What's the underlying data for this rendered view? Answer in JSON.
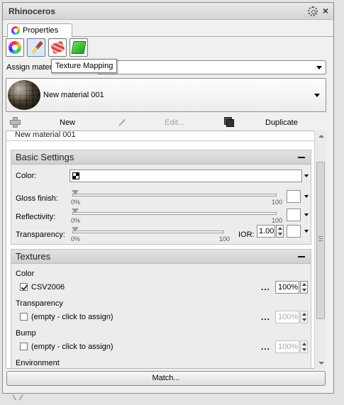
{
  "window": {
    "title": "Rhinoceros"
  },
  "tabs": [
    {
      "label": "Properties"
    }
  ],
  "icon_buttons": [
    {
      "icon": "material-icon"
    },
    {
      "icon": "paintbrush-icon"
    },
    {
      "icon": "texture-mapping-icon"
    },
    {
      "icon": "decal-icon"
    }
  ],
  "tooltip": {
    "text": "Texture Mapping"
  },
  "assign": {
    "label": "Assign mater",
    "value": ""
  },
  "material": {
    "name": "New material 001"
  },
  "toolbar": {
    "new_label": "New",
    "edit_label": "Edit...",
    "duplicate_label": "Duplicate"
  },
  "name_field": {
    "value": "New material 001"
  },
  "basic_settings": {
    "title": "Basic Settings",
    "color_label": "Color:",
    "gloss_label": "Gloss finish:",
    "reflectivity_label": "Reflectivity:",
    "transparency_label": "Transparency:",
    "slider_min": "0%",
    "slider_max": "100",
    "gloss_value": 0,
    "reflectivity_value": 0,
    "transparency_value": 0,
    "ior_label": "IOR:",
    "ior_value": "1.00"
  },
  "textures": {
    "title": "Textures",
    "color_label": "Color",
    "color_texture": "CSV2006",
    "color_checked": true,
    "color_amount": "100%",
    "transparency_label": "Transparency",
    "transparency_texture": "(empty - click to assign)",
    "transparency_amount": "100%",
    "bump_label": "Bump",
    "bump_texture": "(empty - click to assign)",
    "bump_amount": "100%",
    "environment_label": "Environment",
    "dots": "..."
  },
  "match_button": {
    "label": "Match..."
  },
  "colors": {
    "panel_bg": "#f0f0f0",
    "group_header": "#d8d8d8",
    "disabled_text": "#a0a0a0"
  }
}
